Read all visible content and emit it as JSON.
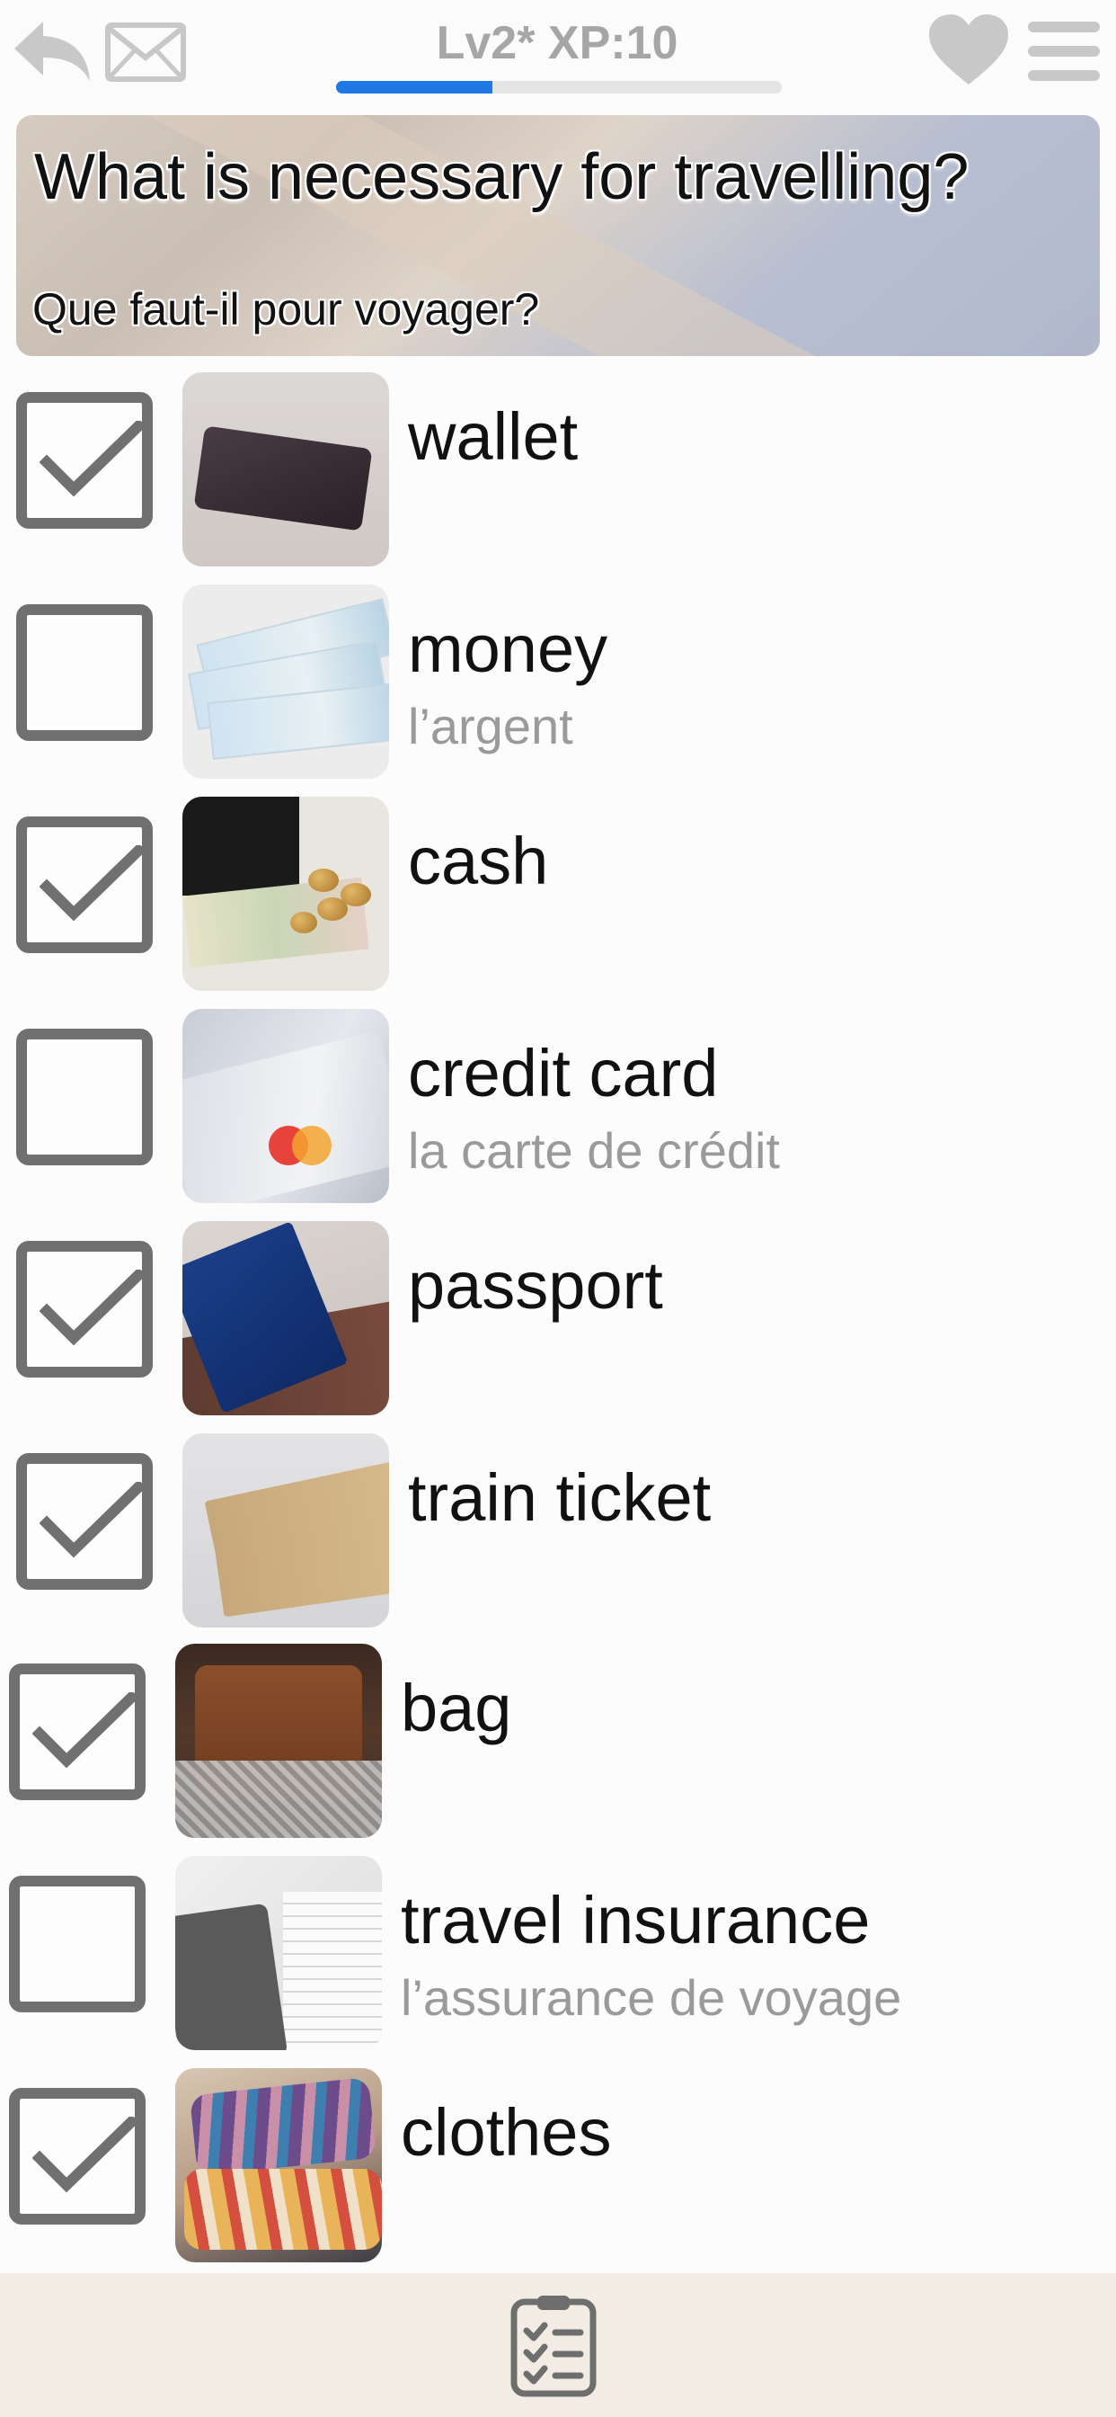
{
  "header": {
    "level_label": "Lv2* XP:10",
    "xp_progress_percent": 35
  },
  "question": {
    "main": "What is necessary for travelling?",
    "sub": "Que faut-il pour voyager?"
  },
  "items": [
    {
      "word": "wallet",
      "translation": "",
      "checked": true
    },
    {
      "word": "money",
      "translation": "l’argent",
      "checked": false
    },
    {
      "word": "cash",
      "translation": "",
      "checked": true
    },
    {
      "word": "credit card",
      "translation": "la carte de crédit",
      "checked": false
    },
    {
      "word": "passport",
      "translation": "",
      "checked": true
    },
    {
      "word": "train ticket",
      "translation": "",
      "checked": true
    },
    {
      "word": "bag",
      "translation": "",
      "checked": true
    },
    {
      "word": "travel insurance",
      "translation": "l’assurance de voyage",
      "checked": false
    },
    {
      "word": "clothes",
      "translation": "",
      "checked": true
    }
  ],
  "colors": {
    "accent": "#1f78e3",
    "icon_gray": "#707070",
    "bottom_bar": "#f3ece4"
  },
  "icons": [
    "back-arrow-icon",
    "mail-icon",
    "heart-icon",
    "menu-icon",
    "checklist-icon"
  ]
}
